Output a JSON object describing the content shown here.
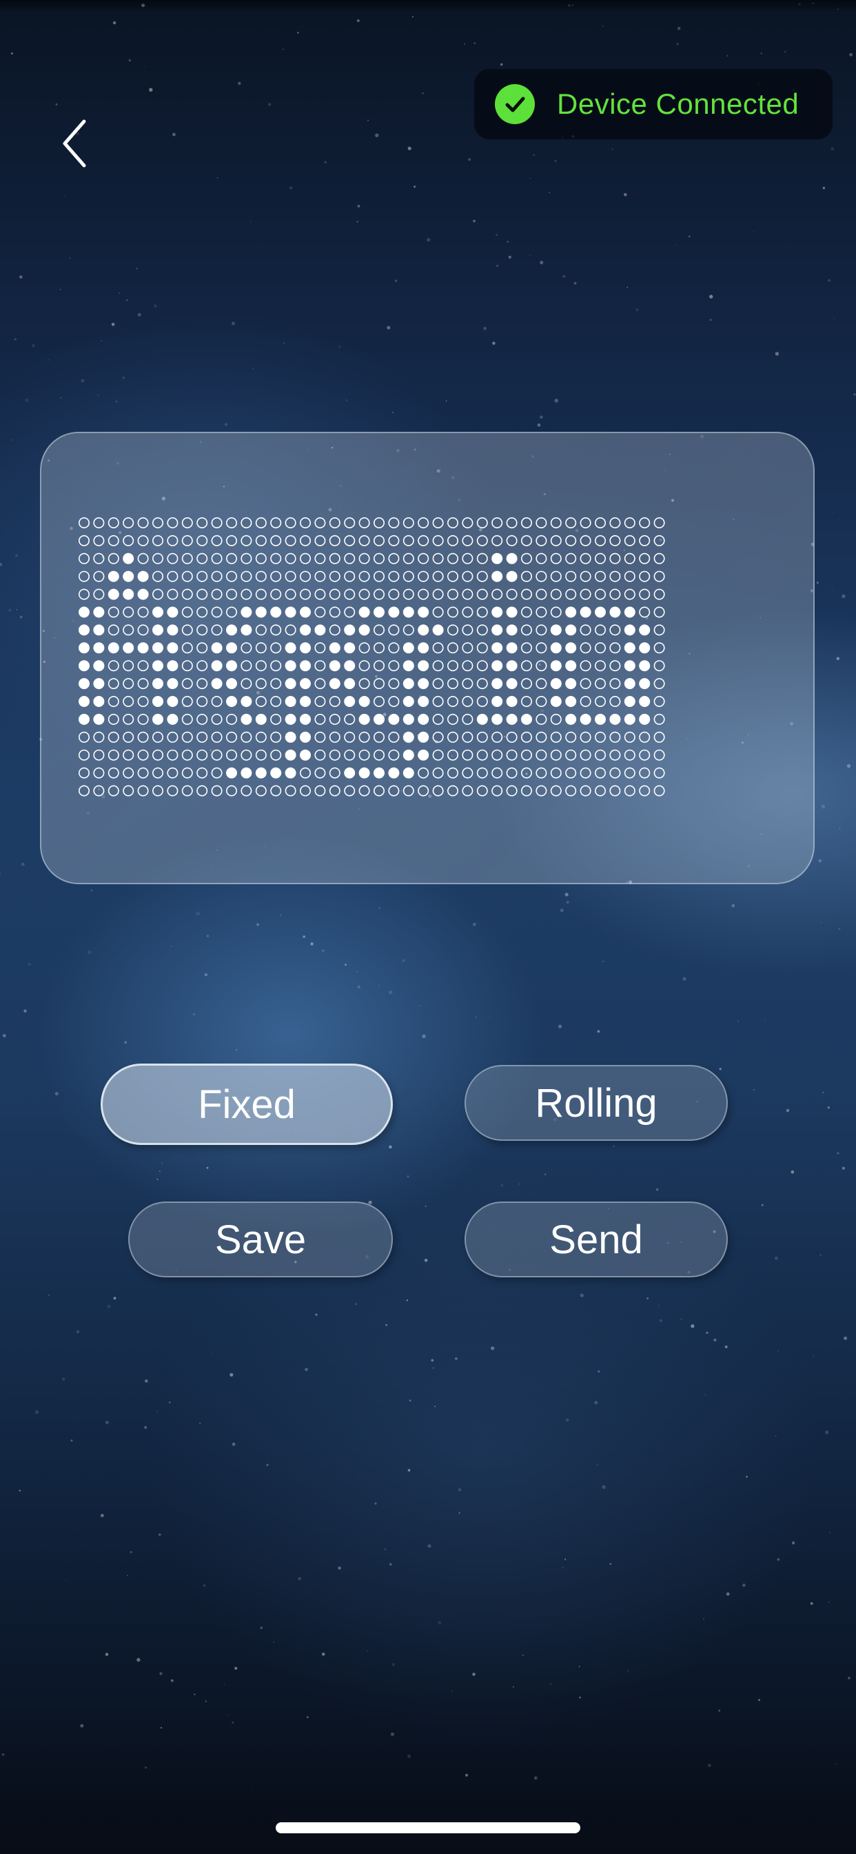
{
  "status": {
    "text": "Device Connected",
    "icon": "check-circle-icon",
    "color": "#63e23c"
  },
  "nav": {
    "back_icon": "chevron-left-icon"
  },
  "led_display": {
    "rows": 16,
    "cols": 40,
    "lit_color": "#ffffff",
    "pattern": [
      "0000000000000000000000000000000000000000",
      "0000000000000000000000000000000000000000",
      "0001000000000000000000000000110000000000",
      "0011100000000000000000000000110000000000",
      "0011100000000000000000000000000000000000",
      "1100011000011111000111110000110001111100",
      "1100011000110001101100011000110011000110",
      "1111111001100011011000110000110011000110",
      "1100011001100011011000110000110011000110",
      "1100011001100011011000110000110011000110",
      "1100011000110011001100110000110011000110",
      "1100011000011011000111110001111001111110",
      "0000000000000011000000110000000000000000",
      "0000000000000011000000110000000000000000",
      "0000000000111110001111100000000000000000",
      "0000000000000000000000000000000000000000"
    ]
  },
  "modes": {
    "fixed": "Fixed",
    "rolling": "Rolling",
    "selected": "fixed"
  },
  "actions": {
    "save": "Save",
    "send": "Send"
  }
}
